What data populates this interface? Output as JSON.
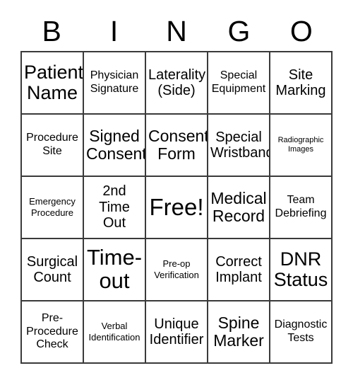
{
  "card": {
    "header_letters": [
      "B",
      "I",
      "N",
      "G",
      "O"
    ],
    "rows": [
      [
        {
          "label": "Patient Name",
          "size": "t-2xl"
        },
        {
          "label": "Physician Signature",
          "size": "t-md"
        },
        {
          "label": "Laterality (Side)",
          "size": "t-lg"
        },
        {
          "label": "Special Equipment",
          "size": "t-md"
        },
        {
          "label": "Site Marking",
          "size": "t-lg"
        }
      ],
      [
        {
          "label": "Procedure Site",
          "size": "t-md"
        },
        {
          "label": "Signed Consent",
          "size": "t-xl"
        },
        {
          "label": "Consent Form",
          "size": "t-xl"
        },
        {
          "label": "Special Wristband",
          "size": "t-lg"
        },
        {
          "label": "Radiographic Images",
          "size": "t-xs"
        }
      ],
      [
        {
          "label": "Emergency Procedure",
          "size": "t-sm"
        },
        {
          "label": "2nd Time Out",
          "size": "t-lg"
        },
        {
          "label": "Free!",
          "size": "t-free"
        },
        {
          "label": "Medical Record",
          "size": "t-xl"
        },
        {
          "label": "Team Debriefing",
          "size": "t-md"
        }
      ],
      [
        {
          "label": "Surgical Count",
          "size": "t-lg"
        },
        {
          "label": "Time-out",
          "size": "t-3xl"
        },
        {
          "label": "Pre-op Verification",
          "size": "t-sm"
        },
        {
          "label": "Correct Implant",
          "size": "t-lg"
        },
        {
          "label": "DNR Status",
          "size": "t-2xl"
        }
      ],
      [
        {
          "label": "Pre-Procedure Check",
          "size": "t-md"
        },
        {
          "label": "Verbal Identification",
          "size": "t-sm"
        },
        {
          "label": "Unique Identifier",
          "size": "t-lg"
        },
        {
          "label": "Spine Marker",
          "size": "t-xl"
        },
        {
          "label": "Diagnostic Tests",
          "size": "t-md"
        }
      ]
    ],
    "free_space": {
      "row": 2,
      "col": 2
    },
    "colors": {
      "background": "#ffffff",
      "border": "#3a3a3a",
      "text": "#000000"
    }
  }
}
